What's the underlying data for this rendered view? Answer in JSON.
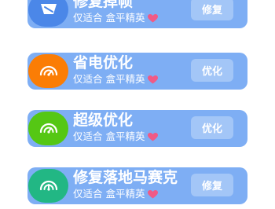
{
  "items": [
    {
      "title": "修复掉帧",
      "subtitle": "仅适合 盒平精英",
      "button": "修复",
      "icon": "phone-frame-icon",
      "icon_color": "#4b87e8"
    },
    {
      "title": "省电优化",
      "subtitle": "仅适合 盒平精英",
      "button": "优化",
      "icon": "speedometer-icon",
      "icon_color": "#fb7d05"
    },
    {
      "title": "超级优化",
      "subtitle": "仅适合 盒平精英",
      "button": "优化",
      "icon": "speedometer-icon",
      "icon_color": "#55c714"
    },
    {
      "title": "修复落地马赛克",
      "subtitle": "仅适合 盒平精英",
      "button": "修复",
      "icon": "speedometer-icon",
      "icon_color": "#22b784"
    }
  ],
  "colors": {
    "card_bg": "#7eaef4",
    "button_bg": "#a3c6f7",
    "heart": "#f05a86",
    "text": "#ffffff"
  }
}
